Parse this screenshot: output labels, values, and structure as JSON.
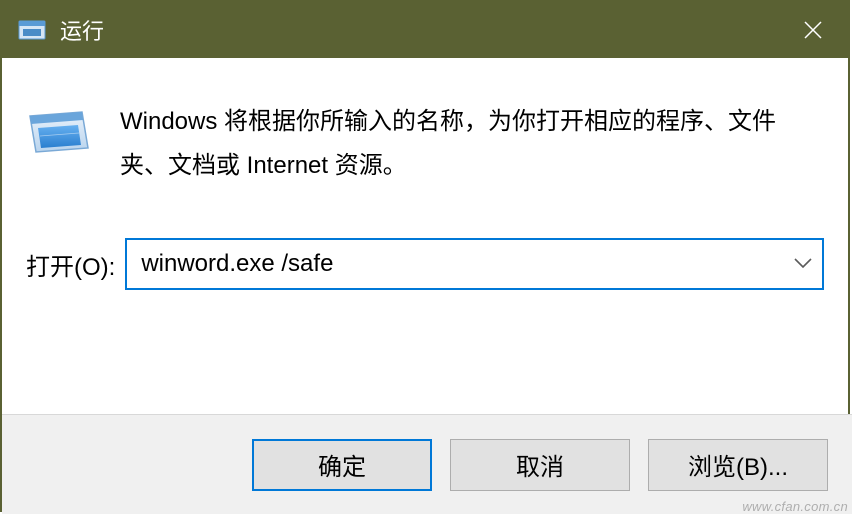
{
  "title_bar": {
    "title": "运行"
  },
  "content": {
    "description": "Windows 将根据你所输入的名称，为你打开相应的程序、文件夹、文档或 Internet 资源。",
    "open_label": "打开(O):",
    "input_value": "winword.exe /safe"
  },
  "buttons": {
    "ok": "确定",
    "cancel": "取消",
    "browse": "浏览(B)..."
  },
  "watermark": "www.cfan.com.cn"
}
